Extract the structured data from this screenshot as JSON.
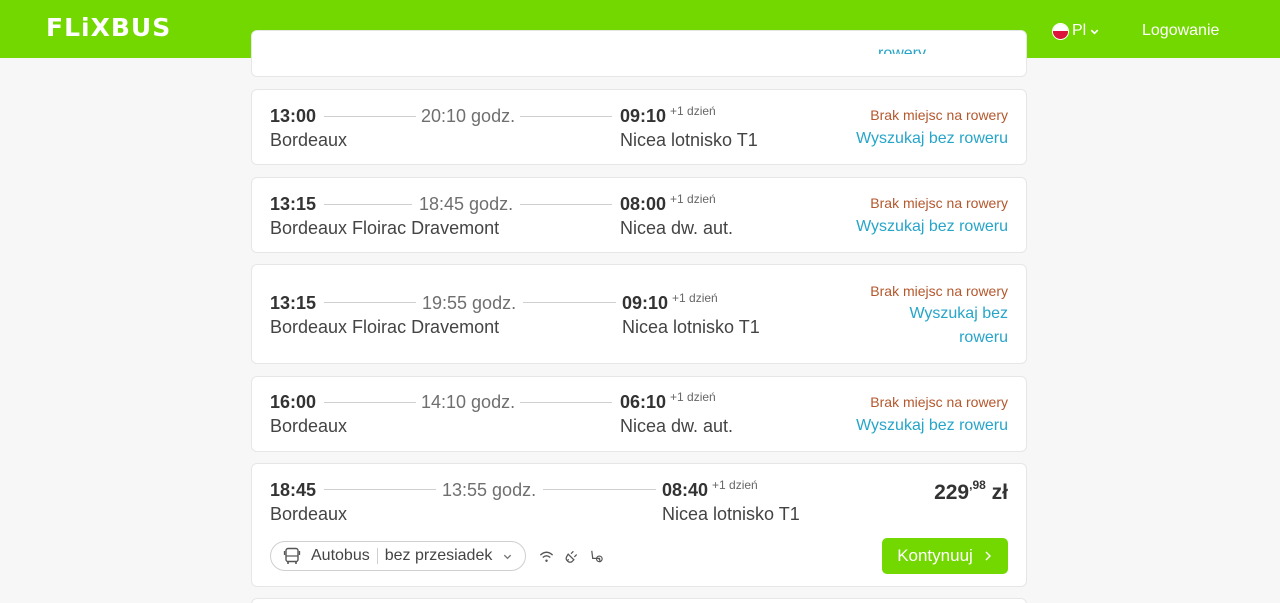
{
  "header": {
    "logo": "FLiXBUS",
    "language": "Pl",
    "login_label": "Logowanie",
    "colors": {
      "brand_green": "#73d700",
      "flag_white": "#ffffff",
      "flag_red": "#dc143c"
    }
  },
  "partial_top_card": {
    "text": "rowery"
  },
  "rides": [
    {
      "dep_time": "13:00",
      "dep_station": "Bordeaux",
      "duration": "20:10 godz.",
      "arr_time": "09:10",
      "arr_plus": "+1 dzień",
      "arr_station": "Nicea lotnisko T1",
      "status": "Brak miejsc na rowery",
      "action": "Wyszukaj bez roweru"
    },
    {
      "dep_time": "13:15",
      "dep_station": "Bordeaux Floirac Dravemont",
      "duration": "18:45 godz.",
      "arr_time": "08:00",
      "arr_plus": "+1 dzień",
      "arr_station": "Nicea dw. aut.",
      "status": "Brak miejsc na rowery",
      "action": "Wyszukaj bez roweru"
    },
    {
      "dep_time": "13:15",
      "dep_station": "Bordeaux Floirac Dravemont",
      "duration": "19:55 godz.",
      "arr_time": "09:10",
      "arr_plus": "+1 dzień",
      "arr_station": "Nicea lotnisko T1",
      "status": "Brak miejsc na rowery",
      "action_line1": "Wyszukaj bez",
      "action_line2": "roweru"
    },
    {
      "dep_time": "16:00",
      "dep_station": "Bordeaux",
      "duration": "14:10 godz.",
      "arr_time": "06:10",
      "arr_plus": "+1 dzień",
      "arr_station": "Nicea dw. aut.",
      "status": "Brak miejsc na rowery",
      "action": "Wyszukaj bez roweru"
    },
    {
      "dep_time": "18:45",
      "dep_station": "Bordeaux",
      "duration": "13:55 godz.",
      "arr_time": "08:40",
      "arr_plus": "+1 dzień",
      "arr_station": "Nicea lotnisko T1",
      "price_main": "229",
      "price_cents": ",98",
      "price_currency": "zł",
      "transport": "Autobus",
      "transfers": "bez przesiadek",
      "amenities": [
        "wifi-icon",
        "power-plug-icon",
        "seat-settings-icon"
      ],
      "cta": "Kontynuuj"
    }
  ],
  "colors": {
    "no_bike": "#b4572d",
    "link": "#26a5c9",
    "cta": "#73d700"
  }
}
